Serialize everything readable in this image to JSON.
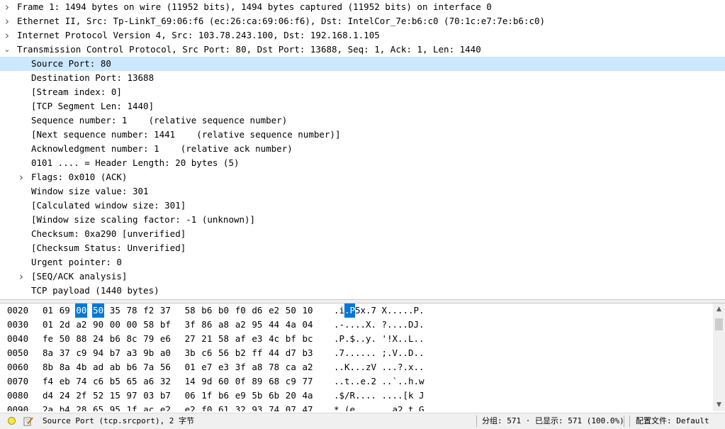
{
  "tree": [
    {
      "text": "Frame 1: 1494 bytes on wire (11952 bits), 1494 bytes captured (11952 bits) on interface 0",
      "level": 0,
      "expander": "collapsed",
      "selected": false
    },
    {
      "text": "Ethernet II, Src: Tp-LinkT_69:06:f6 (ec:26:ca:69:06:f6), Dst: IntelCor_7e:b6:c0 (70:1c:e7:7e:b6:c0)",
      "level": 0,
      "expander": "collapsed",
      "selected": false
    },
    {
      "text": "Internet Protocol Version 4, Src: 103.78.243.100, Dst: 192.168.1.105",
      "level": 0,
      "expander": "collapsed",
      "selected": false
    },
    {
      "text": "Transmission Control Protocol, Src Port: 80, Dst Port: 13688, Seq: 1, Ack: 1, Len: 1440",
      "level": 0,
      "expander": "expanded",
      "selected": false
    },
    {
      "text": "Source Port: 80",
      "level": 1,
      "expander": "none",
      "selected": true
    },
    {
      "text": "Destination Port: 13688",
      "level": 1,
      "expander": "none",
      "selected": false
    },
    {
      "text": "[Stream index: 0]",
      "level": 1,
      "expander": "none",
      "selected": false
    },
    {
      "text": "[TCP Segment Len: 1440]",
      "level": 1,
      "expander": "none",
      "selected": false
    },
    {
      "text": "Sequence number: 1    (relative sequence number)",
      "level": 1,
      "expander": "none",
      "selected": false
    },
    {
      "text": "[Next sequence number: 1441    (relative sequence number)]",
      "level": 1,
      "expander": "none",
      "selected": false
    },
    {
      "text": "Acknowledgment number: 1    (relative ack number)",
      "level": 1,
      "expander": "none",
      "selected": false
    },
    {
      "text": "0101 .... = Header Length: 20 bytes (5)",
      "level": 1,
      "expander": "none",
      "selected": false
    },
    {
      "text": "Flags: 0x010 (ACK)",
      "level": 1,
      "expander": "collapsed",
      "selected": false
    },
    {
      "text": "Window size value: 301",
      "level": 1,
      "expander": "none",
      "selected": false
    },
    {
      "text": "[Calculated window size: 301]",
      "level": 1,
      "expander": "none",
      "selected": false
    },
    {
      "text": "[Window size scaling factor: -1 (unknown)]",
      "level": 1,
      "expander": "none",
      "selected": false
    },
    {
      "text": "Checksum: 0xa290 [unverified]",
      "level": 1,
      "expander": "none",
      "selected": false
    },
    {
      "text": "[Checksum Status: Unverified]",
      "level": 1,
      "expander": "none",
      "selected": false
    },
    {
      "text": "Urgent pointer: 0",
      "level": 1,
      "expander": "none",
      "selected": false
    },
    {
      "text": "[SEQ/ACK analysis]",
      "level": 1,
      "expander": "collapsed",
      "selected": false
    },
    {
      "text": "TCP payload (1440 bytes)",
      "level": 1,
      "expander": "none",
      "selected": false
    }
  ],
  "hex": [
    {
      "offset": "0020",
      "bytes": [
        "01",
        "69",
        "00",
        "50",
        "35",
        "78",
        "f2",
        "37",
        "58",
        "b6",
        "b0",
        "f0",
        "d6",
        "e2",
        "50",
        "10"
      ],
      "ascii": ".i.P5x.7 X.....P.",
      "hl_bytes": [
        2,
        3
      ],
      "hl_ascii": [
        2,
        3
      ]
    },
    {
      "offset": "0030",
      "bytes": [
        "01",
        "2d",
        "a2",
        "90",
        "00",
        "00",
        "58",
        "bf",
        "3f",
        "86",
        "a8",
        "a2",
        "95",
        "44",
        "4a",
        "04"
      ],
      "ascii": ".-....X. ?....DJ.",
      "hl_bytes": [],
      "hl_ascii": []
    },
    {
      "offset": "0040",
      "bytes": [
        "fe",
        "50",
        "88",
        "24",
        "b6",
        "8c",
        "79",
        "e6",
        "27",
        "21",
        "58",
        "af",
        "e3",
        "4c",
        "bf",
        "bc"
      ],
      "ascii": ".P.$..y. '!X..L..",
      "hl_bytes": [],
      "hl_ascii": []
    },
    {
      "offset": "0050",
      "bytes": [
        "8a",
        "37",
        "c9",
        "94",
        "b7",
        "a3",
        "9b",
        "a0",
        "3b",
        "c6",
        "56",
        "b2",
        "ff",
        "44",
        "d7",
        "b3"
      ],
      "ascii": ".7...... ;.V..D..",
      "hl_bytes": [],
      "hl_ascii": []
    },
    {
      "offset": "0060",
      "bytes": [
        "8b",
        "8a",
        "4b",
        "ad",
        "ab",
        "b6",
        "7a",
        "56",
        "01",
        "e7",
        "e3",
        "3f",
        "a8",
        "78",
        "ca",
        "a2"
      ],
      "ascii": "..K...zV ...?.x..",
      "hl_bytes": [],
      "hl_ascii": []
    },
    {
      "offset": "0070",
      "bytes": [
        "f4",
        "eb",
        "74",
        "c6",
        "b5",
        "65",
        "a6",
        "32",
        "14",
        "9d",
        "60",
        "0f",
        "89",
        "68",
        "c9",
        "77"
      ],
      "ascii": "..t..e.2 ..`..h.w",
      "hl_bytes": [],
      "hl_ascii": []
    },
    {
      "offset": "0080",
      "bytes": [
        "d4",
        "24",
        "2f",
        "52",
        "15",
        "97",
        "03",
        "b7",
        "06",
        "1f",
        "b6",
        "e9",
        "5b",
        "6b",
        "20",
        "4a"
      ],
      "ascii": ".$/R.... ....[k J",
      "hl_bytes": [],
      "hl_ascii": []
    },
    {
      "offset": "0090",
      "bytes": [
        "2a",
        "b4",
        "28",
        "65",
        "95",
        "1f",
        "ac",
        "e2",
        "e2",
        "f0",
        "61",
        "32",
        "93",
        "74",
        "07",
        "47"
      ],
      "ascii": "*.(e.... ..a2.t.G",
      "hl_bytes": [],
      "hl_ascii": []
    }
  ],
  "status": {
    "field_info": "Source Port (tcp.srcport), 2 字节",
    "packets": "分组: 571 · 已显示: 571 (100.0%)",
    "profile": "配置文件: Default"
  },
  "colors": {
    "selection": "#cce8ff",
    "byte_highlight": "#0078d7"
  }
}
